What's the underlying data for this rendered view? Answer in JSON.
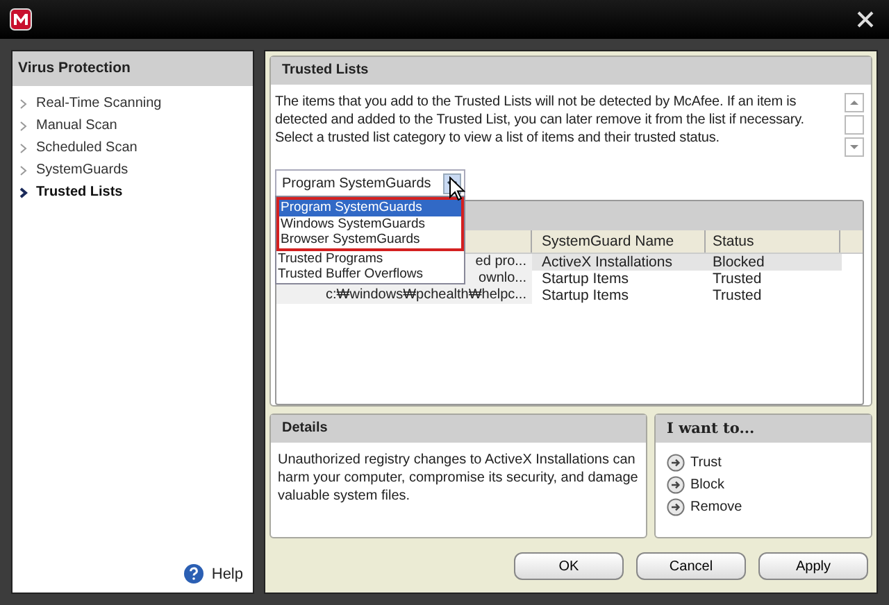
{
  "sidebar": {
    "title": "Virus Protection",
    "items": [
      {
        "label": "Real-Time Scanning",
        "selected": false
      },
      {
        "label": "Manual Scan",
        "selected": false
      },
      {
        "label": "Scheduled Scan",
        "selected": false
      },
      {
        "label": "SystemGuards",
        "selected": false
      },
      {
        "label": "Trusted Lists",
        "selected": true
      }
    ],
    "help": "Help"
  },
  "trusted_lists": {
    "title": "Trusted Lists",
    "description": "The items that you add to the Trusted Lists will not be detected by McAfee. If an item is detected and added to the Trusted List, you can later remove it from the list if necessary. Select a trusted list category to view a list of items and their trusted status.",
    "dropdown": {
      "value": "Program SystemGuards",
      "expanded": true,
      "options": [
        {
          "label": "Program SystemGuards",
          "selected": true,
          "outlined": true
        },
        {
          "label": "Windows SystemGuards",
          "selected": false,
          "outlined": true
        },
        {
          "label": "Browser SystemGuards",
          "selected": false,
          "outlined": true
        },
        {
          "label": "Trusted Programs",
          "selected": false,
          "outlined": false
        },
        {
          "label": "Trusted Buffer Overflows",
          "selected": false,
          "outlined": false
        }
      ]
    },
    "table": {
      "columns": [
        "",
        "SystemGuard Name",
        "Status"
      ],
      "rows": [
        {
          "cells": [
            "ed pro...",
            "ActiveX Installations",
            "Blocked"
          ],
          "selected": true
        },
        {
          "cells": [
            "ownlo...",
            "Startup Items",
            "Trusted"
          ],
          "selected": false
        },
        {
          "cells": [
            "c:₩windows₩pchealth₩helpc...",
            "Startup Items",
            "Trusted"
          ],
          "selected": false
        }
      ]
    }
  },
  "details": {
    "title": "Details",
    "text": "Unauthorized registry changes to ActiveX Installations can harm your computer, compromise its security, and damage valuable system files."
  },
  "actions": {
    "title": "I want to...",
    "items": [
      "Trust",
      "Block",
      "Remove"
    ]
  },
  "buttons": [
    "OK",
    "Cancel",
    "Apply"
  ]
}
